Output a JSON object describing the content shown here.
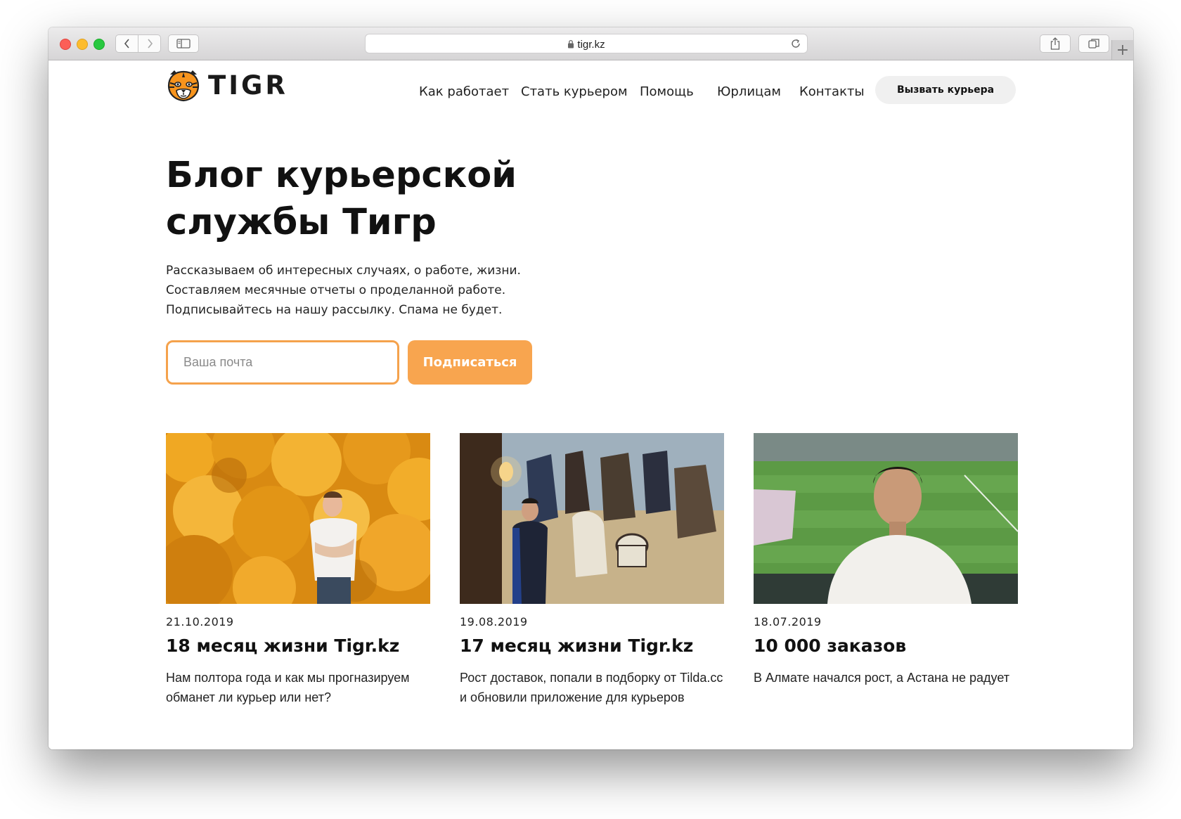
{
  "browser": {
    "url": "tigr.kz"
  },
  "header": {
    "logo_text": "TIGR",
    "nav": [
      {
        "label": "Как работает"
      },
      {
        "label": "Стать курьером"
      },
      {
        "label": "Помощь"
      },
      {
        "label": "Юрлицам"
      },
      {
        "label": "Контакты"
      }
    ],
    "cta_label": "Вызвать курьера"
  },
  "hero": {
    "title": "Блог курьерской службы Тигр",
    "lines": [
      "Рассказываем об интересных случаях, о работе, жизни.",
      "Составляем месячные отчеты о проделанной работе.",
      "Подписывайтесь на нашу рассылку. Спама не будет."
    ],
    "email_placeholder": "Ваша почта",
    "subscribe_label": "Подписаться"
  },
  "posts": [
    {
      "date": "21.10.2019",
      "title": "18 месяц жизни Tigr.kz",
      "description": "Нам полтора года и как мы прогназируем обманет ли курьер или нет?"
    },
    {
      "date": "19.08.2019",
      "title": "17 месяц жизни Tigr.kz",
      "description": "Рост доставок, попали в подборку от Tilda.cc и обновили приложение для курьеров"
    },
    {
      "date": "18.07.2019",
      "title": "10 000 заказов",
      "description": "В Алмате начался рост, а Астана не радует"
    }
  ],
  "colors": {
    "accent": "#f8a54f",
    "accent_border": "#f5a24c",
    "text": "#111111",
    "cta_bg": "#f0f0f0"
  }
}
